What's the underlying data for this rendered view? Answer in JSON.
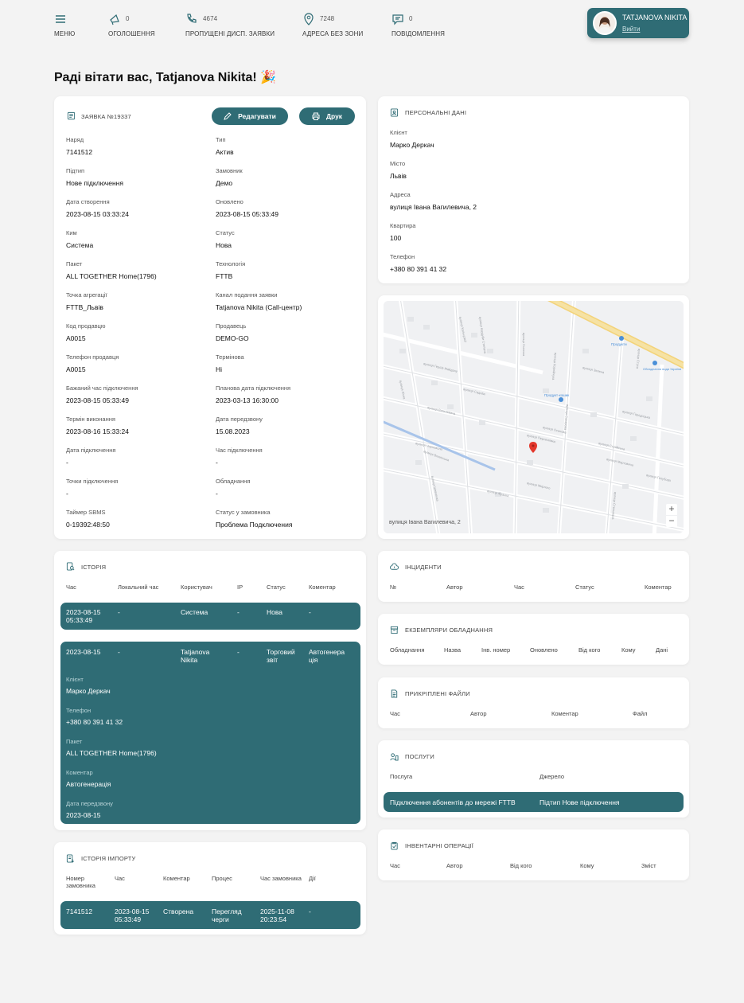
{
  "nav": {
    "menu": {
      "label": "МЕНЮ",
      "icon": "hamburger-icon"
    },
    "announcements": {
      "label": "ОГОЛОШЕННЯ",
      "count": "0",
      "icon": "megaphone-icon"
    },
    "missed": {
      "label": "ПРОПУЩЕНІ ДИСП. ЗАЯВКИ",
      "count": "4674",
      "icon": "phone-icon"
    },
    "nozone": {
      "label": "АДРЕСА БЕЗ ЗОНИ",
      "count": "7248",
      "icon": "map-pin-icon"
    },
    "messages": {
      "label": "ПОВІДОМЛЕННЯ",
      "count": "0",
      "icon": "chat-icon"
    }
  },
  "user": {
    "name": "TATJANOVA NIKITA",
    "logout": "Вийти"
  },
  "greeting": "Раді вітати вас, Tatjanova Nikita! 🎉",
  "ticket": {
    "title": "ЗАЯВКА №19337",
    "edit": "Редагувати",
    "print": "Друк",
    "fields": [
      {
        "label": "Наряд",
        "value": "7141512"
      },
      {
        "label": "Тип",
        "value": "Актив"
      },
      {
        "label": "Підтип",
        "value": "Нове підключення"
      },
      {
        "label": "Замовник",
        "value": "Демо"
      },
      {
        "label": "Дата створення",
        "value": "2023-08-15 03:33:24"
      },
      {
        "label": "Оновлено",
        "value": "2023-08-15 05:33:49"
      },
      {
        "label": "Ким",
        "value": "Система"
      },
      {
        "label": "Статус",
        "value": "Нова"
      },
      {
        "label": "Пакет",
        "value": "ALL TOGETHER Home(1796)"
      },
      {
        "label": "Технологія",
        "value": "FTTB"
      },
      {
        "label": "Точка агрегації",
        "value": "FTTB_Львів"
      },
      {
        "label": "Канал подання заявки",
        "value": "Tatjanova Nikita (Call-центр)"
      },
      {
        "label": "Код продавцю",
        "value": "A0015"
      },
      {
        "label": "Продавець",
        "value": "DEMO-GO"
      },
      {
        "label": "Телефон продавця",
        "value": "A0015"
      },
      {
        "label": "Термінова",
        "value": "Ні"
      },
      {
        "label": "Бажаний час підключення",
        "value": "2023-08-15 05:33:49"
      },
      {
        "label": "Планова дата підключення",
        "value": "2023-03-13 16:30:00"
      },
      {
        "label": "Термін виконання",
        "value": "2023-08-16 15:33:24"
      },
      {
        "label": "Дата передзвону",
        "value": "15.08.2023"
      },
      {
        "label": "Дата підключення",
        "value": "-"
      },
      {
        "label": "Час підключення",
        "value": "-"
      },
      {
        "label": "Точки підключення",
        "value": "-"
      },
      {
        "label": "Обладнання",
        "value": "-"
      },
      {
        "label": "Таймер SBMS",
        "value": "0-19392:48:50"
      },
      {
        "label": "Статус у замовника",
        "value": "Проблема Подключения"
      }
    ]
  },
  "personal": {
    "title": "ПЕРСОНАЛЬНІ ДАНІ",
    "fields": [
      {
        "label": "Клієнт",
        "value": "Марко Деркач"
      },
      {
        "label": "Місто",
        "value": "Львів"
      },
      {
        "label": "Адреса",
        "value": "вулиця Івана Вагилевича, 2"
      },
      {
        "label": "Квартира",
        "value": "100"
      },
      {
        "label": "Телефон",
        "value": "+380 80 391 41 32"
      }
    ]
  },
  "map": {
    "address": "вулиця Івана Вагилевича, 2",
    "zoom_in": "+",
    "zoom_out": "−",
    "poi1": "Продукти",
    "poi2": "Продукт-кошик",
    "poi3": "Обладнання води України",
    "streets": [
      "вулиця Кольцової",
      "вулиця Кордуби Степана",
      "вулиця Гнатюка",
      "вулиця Корнійчука",
      "вулиця Вагилевича",
      "вулиця Садова",
      "вулиця Зелена",
      "вулиця Мартовича",
      "вулиця Городоцька",
      "вулиця Персенківка",
      "вулиця Героїв Майдану",
      "вулиця Чорновола",
      "вулиця Сахарова",
      "вулиця Голубова",
      "вулиця Мирного",
      "вулиця Лісна",
      "вулиця Шевченка",
      "вулиця Франка",
      "вулиця Стрийська",
      "вулиця Стельмаха",
      "вулиця Стуса",
      "вулиця Осипова",
      "вулиця Волинська"
    ]
  },
  "history": {
    "title": "ІСТОРІЯ",
    "headers": [
      "Час",
      "Локальний час",
      "Користувач",
      "IP",
      "Статус",
      "Коментар"
    ],
    "rows": [
      {
        "time": "2023-08-15 05:33:49",
        "local": "-",
        "user": "Система",
        "ip": "-",
        "status": "Нова",
        "comment": "-"
      },
      {
        "time": "2023-08-15",
        "local": "-",
        "user": "Tatjanova Nikita",
        "ip": "-",
        "status": "Торговий звіт",
        "comment": "Автогенера ція"
      }
    ],
    "details": [
      {
        "label": "Клієнт",
        "value": "Марко Деркач"
      },
      {
        "label": "Телефон",
        "value": "+380 80 391 41 32"
      },
      {
        "label": "Пакет",
        "value": "ALL TOGETHER Home(1796)"
      },
      {
        "label": "Коментар",
        "value": "Автогенерація"
      },
      {
        "label": "Дата передзвону",
        "value": "2023-08-15"
      }
    ]
  },
  "import": {
    "title": "ІСТОРІЯ ІМПОРТУ",
    "headers": [
      "Номер замовника",
      "Час",
      "Коментар",
      "Процес",
      "Час замовника",
      "Дії"
    ],
    "row": {
      "num": "7141512",
      "time": "2023-08-15 05:33:49",
      "comment": "Створена",
      "process": "Перегляд черги",
      "ctime": "2025-11-08 20:23:54",
      "actions": "-"
    }
  },
  "incidents": {
    "title": "ІНЦИДЕНТИ",
    "headers": [
      "№",
      "Автор",
      "Час",
      "Статус",
      "Коментар"
    ]
  },
  "equipment": {
    "title": "ЕКЗЕМПЛЯРИ ОБЛАДНАННЯ",
    "headers": [
      "Обладнання",
      "Назва",
      "Інв. номер",
      "Оновлено",
      "Від кого",
      "Кому",
      "Дані"
    ]
  },
  "files": {
    "title": "ПРИКРІПЛЕНІ ФАЙЛИ",
    "headers": [
      "Час",
      "Автор",
      "Коментар",
      "Файл"
    ]
  },
  "services": {
    "title": "ПОСЛУГИ",
    "headers": [
      "Послуга",
      "Джерело"
    ],
    "row": {
      "service": "Підключення абонентів до мережі FTTB",
      "source": "Підтип Нове підключення"
    }
  },
  "inventory": {
    "title": "ІНВЕНТАРНІ ОПЕРАЦІЇ",
    "headers": [
      "Час",
      "Автор",
      "Від кого",
      "Кому",
      "Зміст"
    ]
  },
  "colors": {
    "accent": "#2f6c75",
    "background": "#f3f3f3"
  }
}
